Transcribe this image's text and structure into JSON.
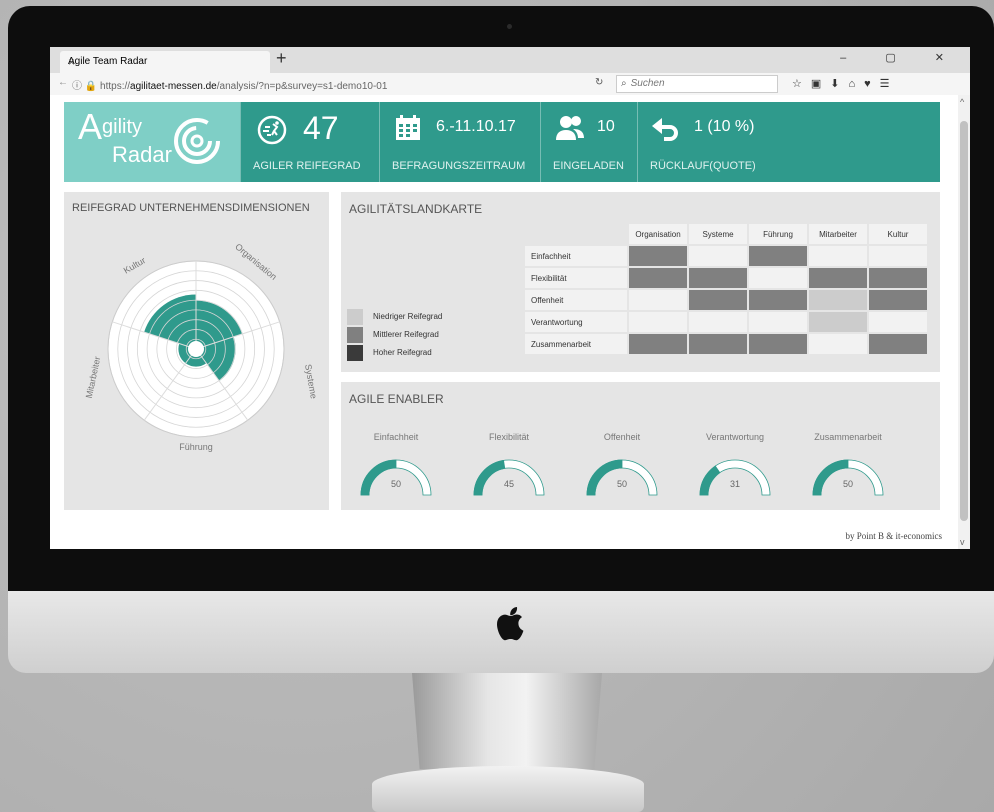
{
  "browser": {
    "tab_title": "Agile Team Radar",
    "tab_close": "×",
    "new_tab": "+",
    "window_controls": "–  ▢  ✕",
    "url_prefix": "https://",
    "url_host": "agilitaet-messen.de",
    "url_rest": "/analysis/?n=p&survey=s1-demo10-01",
    "search_placeholder": "Suchen"
  },
  "header": {
    "logo_line1_big": "A",
    "logo_line1_rest": "gility",
    "logo_line2": "Radar",
    "stats": [
      {
        "value": "47",
        "label": "AGILER REIFEGRAD"
      },
      {
        "value": "6.-11.10.17",
        "label": "BEFRAGUNGSZEITRAUM"
      },
      {
        "value": "10",
        "label": "EINGELADEN"
      },
      {
        "value": "1 (10 %)",
        "label": "RÜCKLAUF(QUOTE)"
      }
    ]
  },
  "radar_panel": {
    "title": "REIFEGRAD UNTERNEHMENSDIMENSIONEN",
    "labels": [
      "Kultur",
      "Organisation",
      "Systeme",
      "Führung",
      "Mitarbeiter"
    ],
    "levels": [
      {
        "dimension": "Organisation",
        "level": 0.55
      },
      {
        "dimension": "Systeme",
        "level": 0.45
      },
      {
        "dimension": "Führung",
        "level": 0.2
      },
      {
        "dimension": "Mitarbeiter",
        "level": 0.2
      },
      {
        "dimension": "Kultur",
        "level": 0.62
      }
    ]
  },
  "map_panel": {
    "title": "AGILITÄTSLANDKARTE",
    "columns": [
      "Organisation",
      "Systeme",
      "Führung",
      "Mitarbeiter",
      "Kultur"
    ],
    "rows": [
      "Einfachheit",
      "Flexibilität",
      "Offenheit",
      "Verantwortung",
      "Zusammenarbeit"
    ],
    "legend": [
      "Niedriger Reifegrad",
      "Mittlerer Reifegrad",
      "Hoher Reifegrad"
    ],
    "cells": [
      [
        "mid",
        "none",
        "mid",
        "none",
        "none"
      ],
      [
        "mid",
        "mid",
        "none",
        "mid",
        "mid"
      ],
      [
        "none",
        "mid",
        "mid",
        "low",
        "mid"
      ],
      [
        "none",
        "none",
        "none",
        "low",
        "none"
      ],
      [
        "mid",
        "mid",
        "mid",
        "none",
        "mid"
      ]
    ],
    "colors": {
      "none": "#f2f2f2",
      "low": "#cccccc",
      "mid": "#808080",
      "high": "#3a3a3a"
    }
  },
  "enabler_panel": {
    "title": "AGILE ENABLER",
    "gauges": [
      {
        "label": "Einfachheit",
        "value": "50"
      },
      {
        "label": "Flexibilität",
        "value": "45"
      },
      {
        "label": "Offenheit",
        "value": "50"
      },
      {
        "label": "Verantwortung",
        "value": "31"
      },
      {
        "label": "Zusammenarbeit",
        "value": "50"
      }
    ],
    "accent": "#2f9a8c"
  },
  "footer": "by Point B & it-economics"
}
